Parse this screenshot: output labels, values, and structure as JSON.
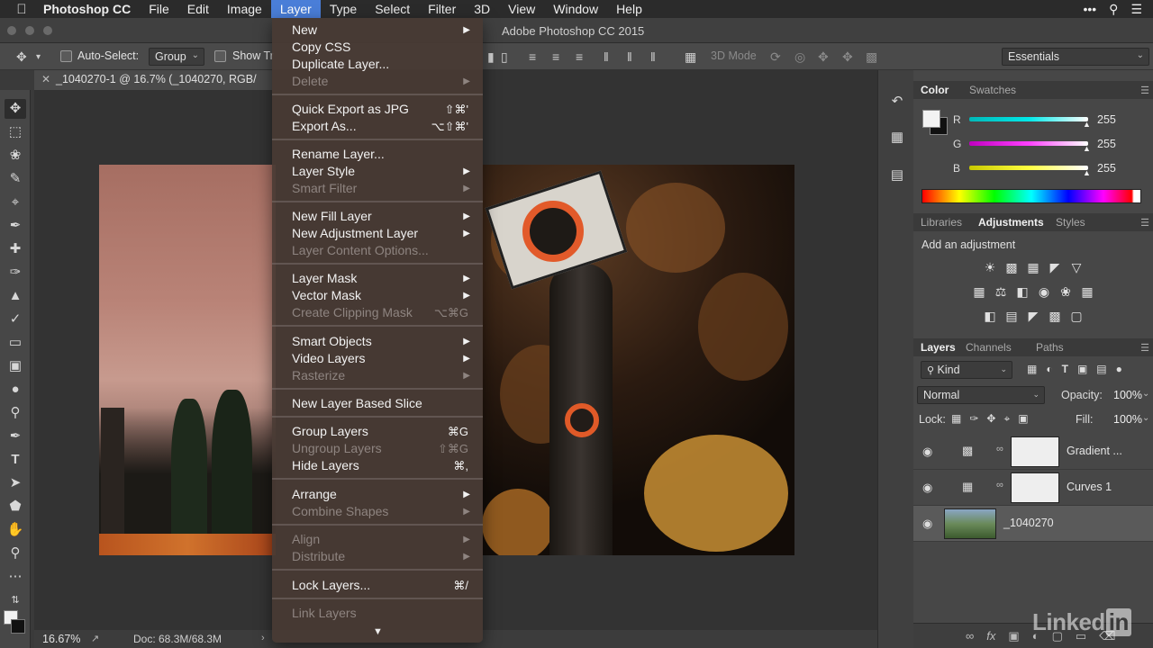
{
  "menubar": {
    "app": "Photoshop CC",
    "items": [
      "File",
      "Edit",
      "Image",
      "Layer",
      "Type",
      "Select",
      "Filter",
      "3D",
      "View",
      "Window",
      "Help"
    ],
    "active": "Layer"
  },
  "window": {
    "title": "Adobe Photoshop CC 2015"
  },
  "options": {
    "auto_select_label": "Auto-Select:",
    "auto_select_value": "Group",
    "show_transform_label": "Show Tr",
    "mode_3d": "3D Mode",
    "workspace": "Essentials"
  },
  "document": {
    "tab_title": "_1040270-1 @ 16.7% (_1040270, RGB/",
    "zoom": "16.67%",
    "doc_info": "Doc: 68.3M/68.3M"
  },
  "layer_menu": {
    "items": [
      {
        "label": "New",
        "submenu": true,
        "disabled": false
      },
      {
        "label": "Copy CSS",
        "disabled": false
      },
      {
        "label": "Duplicate Layer...",
        "disabled": false
      },
      {
        "label": "Delete",
        "submenu": true,
        "disabled": true
      },
      {
        "label": "Quick Export as JPG",
        "shortcut": "⇧⌘'",
        "disabled": false
      },
      {
        "label": "Export As...",
        "shortcut": "⌥⇧⌘'",
        "disabled": false
      },
      {
        "label": "Rename Layer...",
        "disabled": false
      },
      {
        "label": "Layer Style",
        "submenu": true,
        "disabled": false
      },
      {
        "label": "Smart Filter",
        "submenu": true,
        "disabled": true
      },
      {
        "label": "New Fill Layer",
        "submenu": true,
        "disabled": false
      },
      {
        "label": "New Adjustment Layer",
        "submenu": true,
        "disabled": false
      },
      {
        "label": "Layer Content Options...",
        "disabled": true
      },
      {
        "label": "Layer Mask",
        "submenu": true,
        "disabled": false
      },
      {
        "label": "Vector Mask",
        "submenu": true,
        "disabled": false
      },
      {
        "label": "Create Clipping Mask",
        "shortcut": "⌥⌘G",
        "disabled": true
      },
      {
        "label": "Smart Objects",
        "submenu": true,
        "disabled": false
      },
      {
        "label": "Video Layers",
        "submenu": true,
        "disabled": false
      },
      {
        "label": "Rasterize",
        "submenu": true,
        "disabled": true
      },
      {
        "label": "New Layer Based Slice",
        "disabled": false
      },
      {
        "label": "Group Layers",
        "shortcut": "⌘G",
        "disabled": false
      },
      {
        "label": "Ungroup Layers",
        "shortcut": "⇧⌘G",
        "disabled": true
      },
      {
        "label": "Hide Layers",
        "shortcut": "⌘,",
        "disabled": false
      },
      {
        "label": "Arrange",
        "submenu": true,
        "disabled": false
      },
      {
        "label": "Combine Shapes",
        "submenu": true,
        "disabled": true
      },
      {
        "label": "Align",
        "submenu": true,
        "disabled": true
      },
      {
        "label": "Distribute",
        "submenu": true,
        "disabled": true
      },
      {
        "label": "Lock Layers...",
        "shortcut": "⌘/",
        "disabled": false
      },
      {
        "label": "Link Layers",
        "disabled": true
      }
    ]
  },
  "color_panel": {
    "tabs": [
      "Color",
      "Swatches"
    ],
    "active_tab": "Color",
    "channels": [
      {
        "label": "R",
        "value": "255",
        "color": "#00e0e0"
      },
      {
        "label": "G",
        "value": "255",
        "color": "#e000e0"
      },
      {
        "label": "B",
        "value": "255",
        "color": "#e6e600"
      }
    ]
  },
  "adjustments_panel": {
    "tabs": [
      "Libraries",
      "Adjustments",
      "Styles"
    ],
    "active_tab": "Adjustments",
    "heading": "Add an adjustment"
  },
  "layers_panel": {
    "tabs": [
      "Layers",
      "Channels",
      "Paths"
    ],
    "active_tab": "Layers",
    "filter_kind": "Kind",
    "blend_mode": "Normal",
    "opacity_label": "Opacity:",
    "opacity": "100%",
    "lock_label": "Lock:",
    "fill_label": "Fill:",
    "fill": "100%",
    "layers": [
      {
        "name": "Gradient ...",
        "type": "adjustment",
        "icon": "gradient-map-icon",
        "selected": false
      },
      {
        "name": "Curves 1",
        "type": "adjustment",
        "icon": "curves-icon",
        "selected": false
      },
      {
        "name": "_1040270",
        "type": "image",
        "selected": true
      }
    ]
  },
  "watermark": {
    "text": "Linked",
    "in": "in"
  }
}
